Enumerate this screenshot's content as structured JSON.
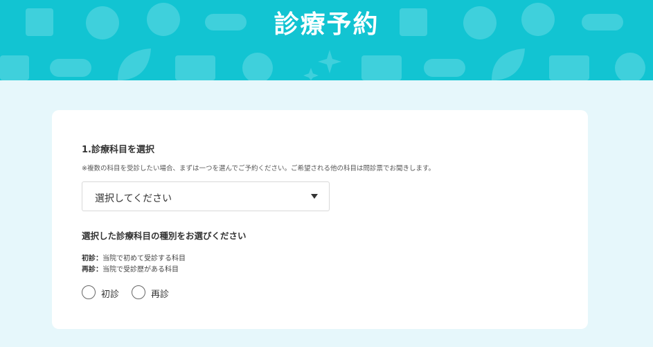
{
  "header": {
    "title": "診療予約",
    "background_color": "#12c4d2"
  },
  "department_section": {
    "title": "1.診療科目を選択",
    "note": "※複数の科目を受診したい場合、まずは一つを選んでご予約ください。ご希望される他の科目は問診票でお聞きします。",
    "select": {
      "value": "選択してください"
    }
  },
  "visit_type_section": {
    "title": "選択した診療科目の種別をお選びください",
    "definitions": [
      {
        "term": "初診",
        "separator": "：",
        "description": "当院で初めて受診する科目"
      },
      {
        "term": "再診",
        "separator": "：",
        "description": "当院で受診歴がある科目"
      }
    ],
    "options": [
      {
        "label": "初診",
        "selected": false
      },
      {
        "label": "再診",
        "selected": false
      }
    ]
  }
}
